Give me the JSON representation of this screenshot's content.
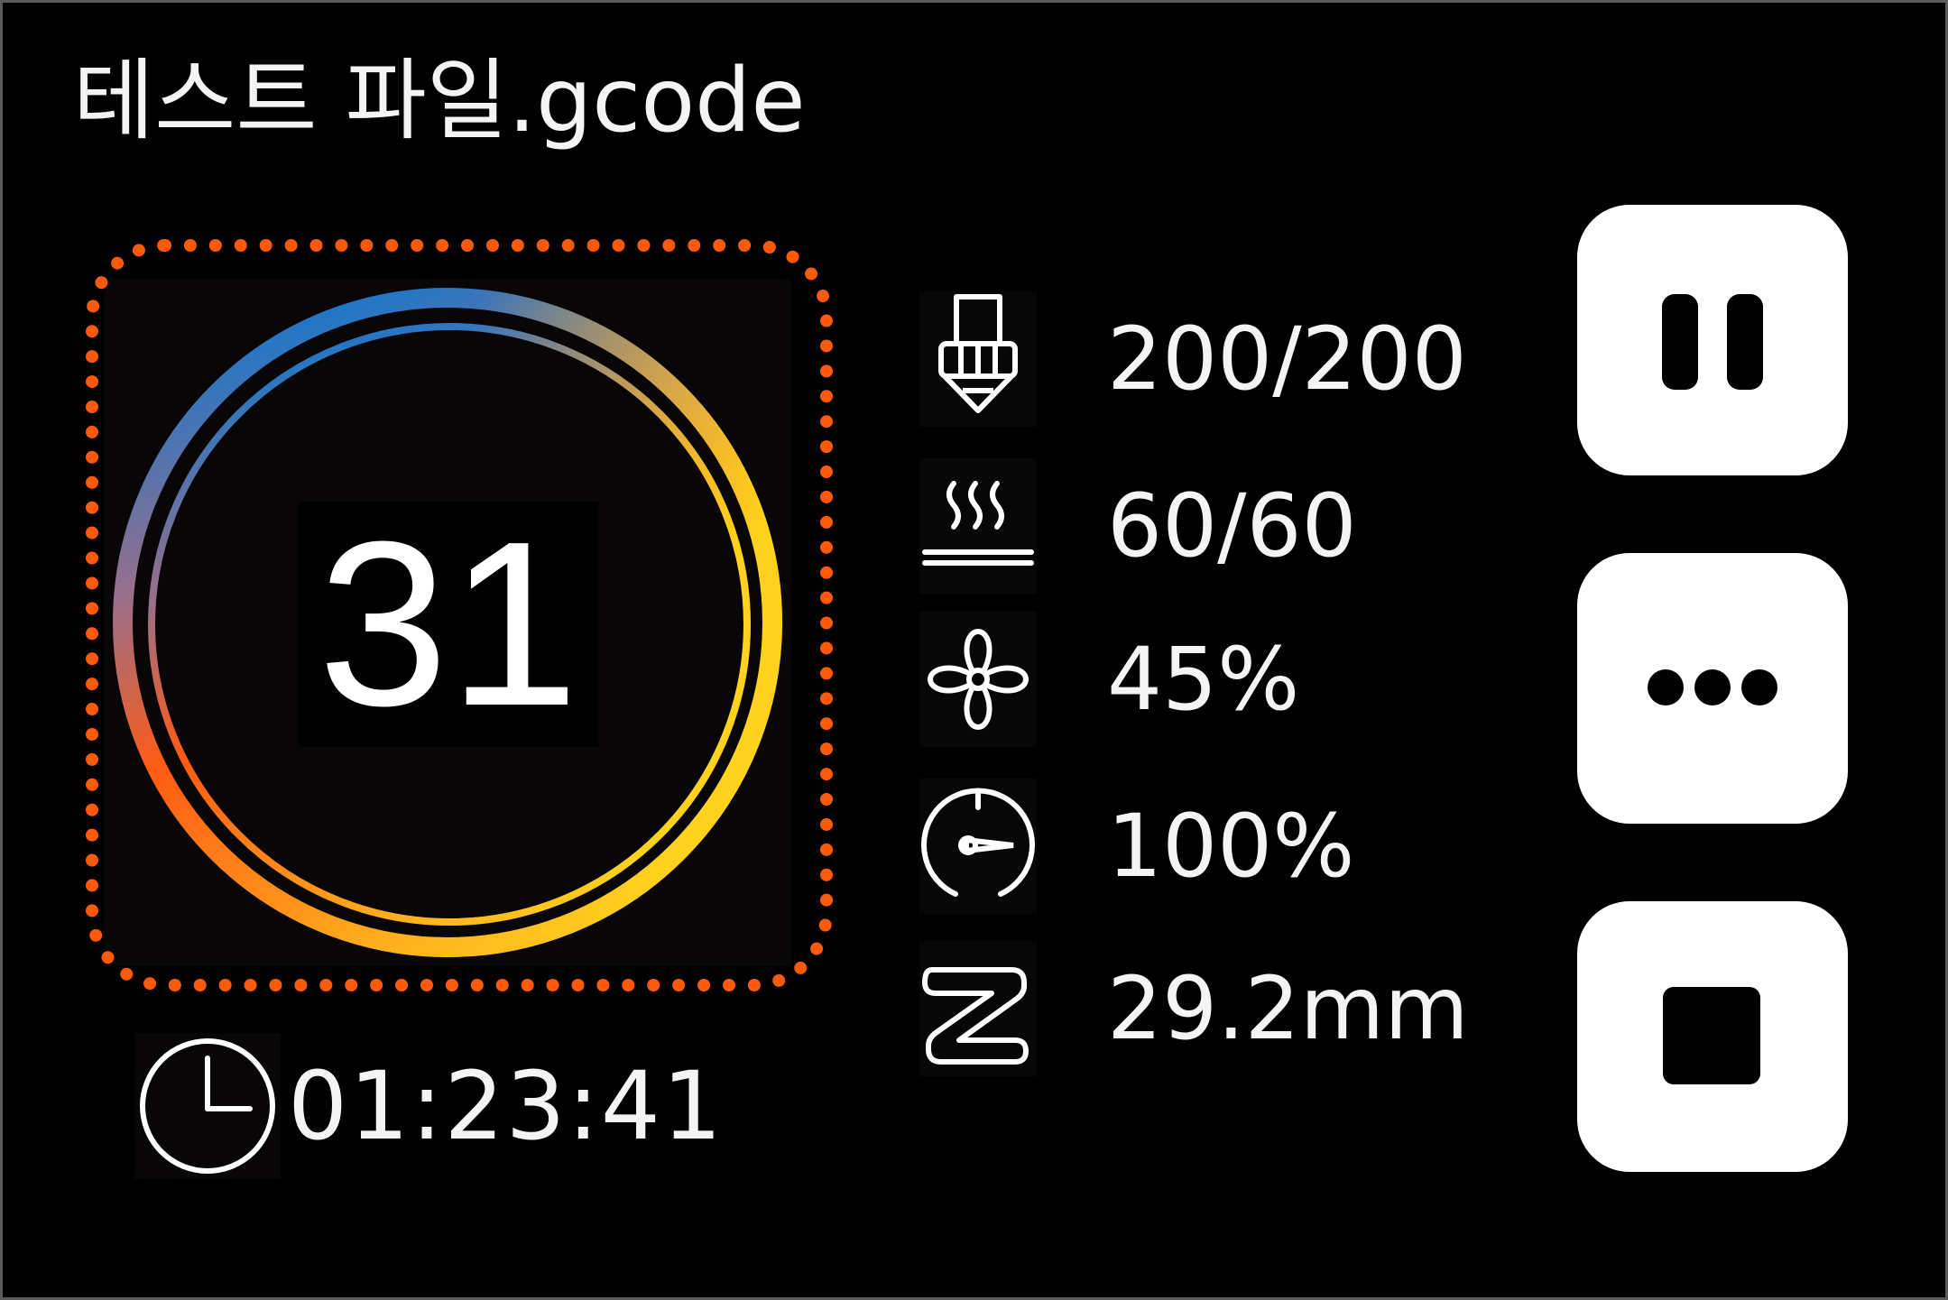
{
  "file": {
    "name": "테스트 파일.gcode"
  },
  "progress": {
    "value": 31,
    "label": "31",
    "ring_colors": [
      "#0a78d2",
      "#ffc81e",
      "#ff3c0a"
    ],
    "frame_color": "#ff5a0a"
  },
  "time": {
    "icon": "clock-icon",
    "elapsed": "01:23:41"
  },
  "stats": {
    "nozzle": {
      "icon": "nozzle-icon",
      "value": "200/200"
    },
    "bed": {
      "icon": "heated-bed-icon",
      "value": "60/60"
    },
    "fan": {
      "icon": "fan-icon",
      "value": "45%"
    },
    "speed": {
      "icon": "speedometer-icon",
      "value": "100%"
    },
    "z": {
      "icon": "z-axis-icon",
      "value": "29.2mm"
    }
  },
  "controls": [
    {
      "icon": "pause-icon"
    },
    {
      "icon": "more-icon"
    },
    {
      "icon": "stop-icon"
    }
  ]
}
